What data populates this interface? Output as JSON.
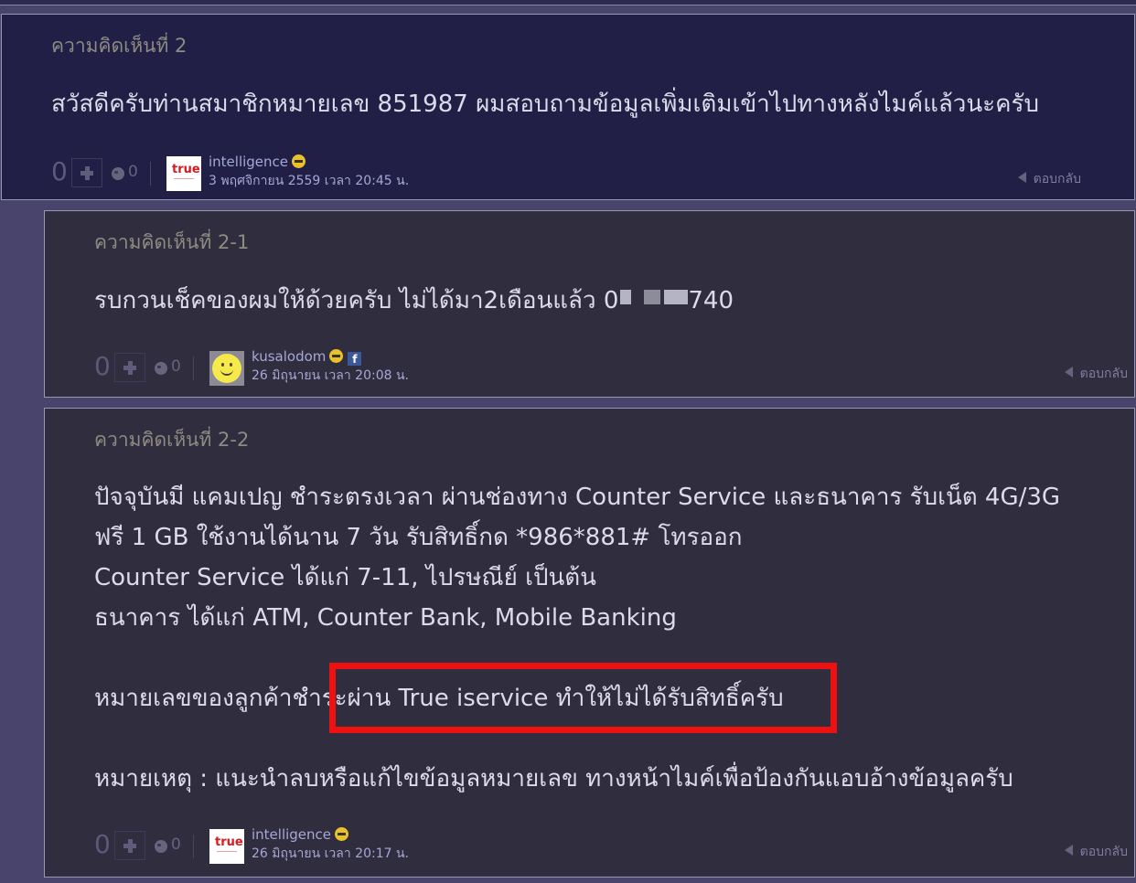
{
  "comments": [
    {
      "title": "ความคิดเห็นที่ 2",
      "body": [
        "สวัสดีครับท่านสมาชิกหมายเลข 851987 ผมสอบถามข้อมูลเพิ่มเติมเข้าไปทางหลังไมค์แล้วนะครับ"
      ],
      "votes": "0",
      "emotions": "0",
      "username": "intelligence",
      "date": "3 พฤศจิกายน 2559 เวลา 20:45 น.",
      "reply_label": "ตอบกลับ"
    },
    {
      "title": "ความคิดเห็นที่ 2-1",
      "body_text": "รบกวนเช็คของผมให้ด้วยครับ ไม่ได้มา2เดือนแล้ว 0",
      "body_tail": "740",
      "votes": "0",
      "emotions": "0",
      "username": "kusalodom",
      "date": "26 มิถุนายน เวลา 20:08 น.",
      "reply_label": "ตอบกลับ"
    },
    {
      "title": "ความคิดเห็นที่ 2-2",
      "body": [
        "ปัจจุบันมี แคมเปญ ชำระตรงเวลา ผ่านช่องทาง Counter Service และธนาคาร รับเน็ต 4G/3G",
        "ฟรี 1 GB ใช้งานได้นาน 7 วัน รับสิทธิ์กด *986*881# โทรออก",
        "Counter Service ได้แก่ 7-11, ไปรษณีย์ เป็นต้น",
        "ธนาคาร ได้แก่ ATM, Counter Bank, Mobile Banking",
        "หมายเลขของลูกค้าชำระผ่าน True iservice ทำให้ไม่ได้รับสิทธิ์ครับ",
        "หมายเหตุ : แนะนำลบหรือแก้ไขข้อมูลหมายเลข ทางหน้าไมค์เพื่อป้องกันแอบอ้างข้อมูลครับ"
      ],
      "votes": "0",
      "emotions": "0",
      "username": "intelligence",
      "date": "26 มิถุนายน เวลา 20:17 น.",
      "reply_label": "ตอบกลับ"
    }
  ],
  "avatars": {
    "true_logo_text": "true",
    "fb_glyph": "f"
  },
  "colors": {
    "highlight": "#ee1111",
    "main_comment_bg": "#211f46",
    "reply_bg": "#302d3f"
  }
}
